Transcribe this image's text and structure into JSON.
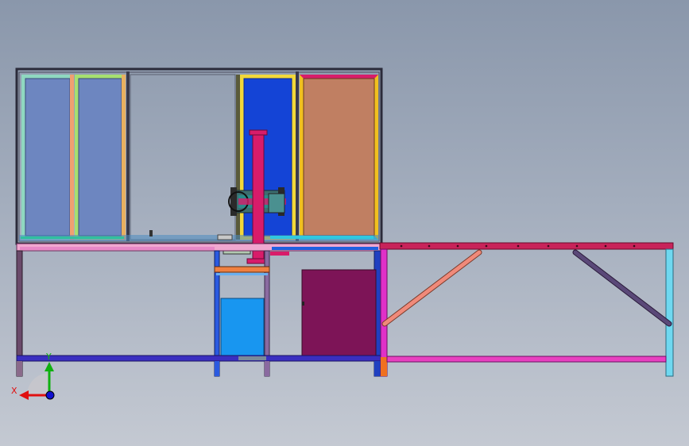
{
  "viewport": {
    "background_top": "#8a97ab",
    "background_bottom": "#c4c9d2"
  },
  "triad": {
    "x_label": "X",
    "y_label": "Y",
    "x_color": "#e01010",
    "y_color": "#10b010",
    "z_color": "#1010d0"
  },
  "colors": {
    "frame_dark": "#2b2b3a",
    "panel_blue_light": "#6d86c0",
    "panel_blue": "#5e7cc0",
    "panel_blue_bright": "#1444d6",
    "panel_orange": "#c07f62",
    "door_maroon": "#7d1457",
    "tank_blue": "#1896f0",
    "column_magenta": "#d81c6a",
    "table_top_magenta": "#c8235a",
    "bottom_rail_purple": "#3a2ec0",
    "brace_salmon": "#f08a7a",
    "brace_purple": "#5a4878",
    "leg_cyan": "#6fd8f0",
    "rail_pink": "#e840c0"
  }
}
